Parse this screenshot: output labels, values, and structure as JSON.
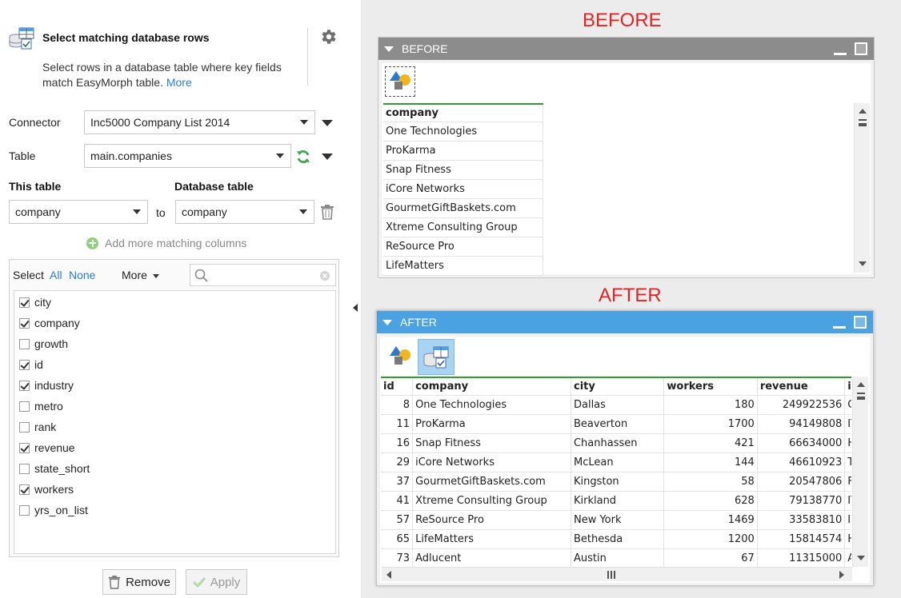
{
  "header": {
    "title": "Select matching database rows",
    "description": "Select rows in a database table where key fields match EasyMorph table.",
    "more_link": "More"
  },
  "form": {
    "connector_label": "Connector",
    "connector_value": "Inc5000 Company List 2014",
    "table_label": "Table",
    "table_value": "main.companies",
    "this_table_label": "This table",
    "database_table_label": "Database table",
    "this_table_value": "company",
    "to_label": "to",
    "database_table_value": "company",
    "add_more_label": "Add more matching columns"
  },
  "columns_list": {
    "select_label": "Select",
    "all_label": "All",
    "none_label": "None",
    "more_label": "More",
    "search_placeholder": "",
    "items": [
      {
        "name": "city",
        "checked": true
      },
      {
        "name": "company",
        "checked": true
      },
      {
        "name": "growth",
        "checked": false
      },
      {
        "name": "id",
        "checked": true
      },
      {
        "name": "industry",
        "checked": true
      },
      {
        "name": "metro",
        "checked": false
      },
      {
        "name": "rank",
        "checked": false
      },
      {
        "name": "revenue",
        "checked": true
      },
      {
        "name": "state_short",
        "checked": false
      },
      {
        "name": "workers",
        "checked": true
      },
      {
        "name": "yrs_on_list",
        "checked": false
      }
    ]
  },
  "buttons": {
    "remove_label": "Remove",
    "apply_label": "Apply"
  },
  "before": {
    "big_label": "BEFORE",
    "panel_title": "BEFORE",
    "column": "company",
    "rows": [
      "One Technologies",
      "ProKarma",
      "Snap Fitness",
      "iCore Networks",
      "GourmetGiftBaskets.com",
      "Xtreme Consulting Group",
      "ReSource Pro",
      "LifeMatters"
    ]
  },
  "after": {
    "big_label": "AFTER",
    "panel_title": "AFTER",
    "columns": [
      "id",
      "company",
      "city",
      "workers",
      "revenue",
      "industry"
    ],
    "rows": [
      [
        "8",
        "One Technologies",
        "Dallas",
        "180",
        "249922536",
        "Consumer Pr..."
      ],
      [
        "11",
        "ProKarma",
        "Beaverton",
        "1700",
        "94149808",
        "IT Services"
      ],
      [
        "16",
        "Snap Fitness",
        "Chanhassen",
        "421",
        "66634000",
        "Health"
      ],
      [
        "29",
        "iCore Networks",
        "McLean",
        "144",
        "46610923",
        "Telecommuni..."
      ],
      [
        "37",
        "GourmetGiftBaskets.com",
        "Kingston",
        "58",
        "20547806",
        "Food & Beve..."
      ],
      [
        "41",
        "Xtreme Consulting Group",
        "Kirkland",
        "628",
        "79138770",
        "IT Services"
      ],
      [
        "57",
        "ReSource Pro",
        "New York",
        "1469",
        "33583810",
        "Insurance"
      ],
      [
        "65",
        "LifeMatters",
        "Bethesda",
        "1200",
        "15814574",
        "Health"
      ],
      [
        "73",
        "Adlucent",
        "Austin",
        "67",
        "11315000",
        "Advertising..."
      ]
    ]
  },
  "colors": {
    "before_title_bg": "#8c8c8c",
    "after_title_bg": "#4aa3e0",
    "accent_link": "#2b7bd6",
    "label_red": "#e02424",
    "header_rule_green": "#2aa02a"
  },
  "icons": {
    "action_icon": "database-table-match-icon",
    "settings": "gear-icon",
    "refresh": "refresh-icon",
    "delete": "trash-icon",
    "search": "search-icon",
    "clear": "clear-icon",
    "shapes": "shapes-icon"
  }
}
